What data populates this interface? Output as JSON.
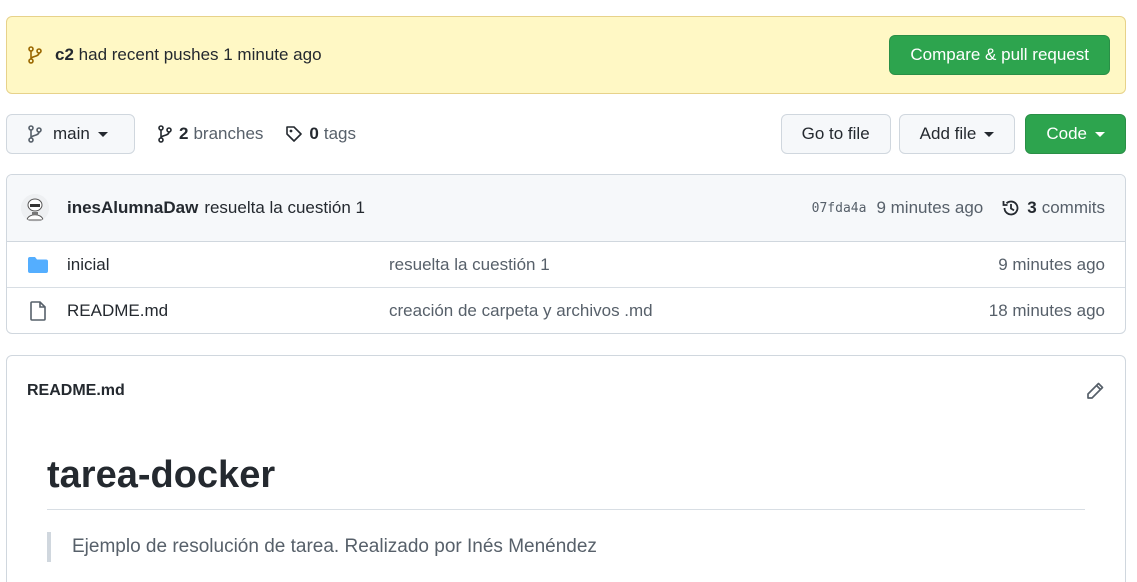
{
  "banner": {
    "branch": "c2",
    "message": "had recent pushes 1 minute ago",
    "button": "Compare & pull request"
  },
  "toolbar": {
    "branch": "main",
    "branches_count": "2",
    "branches_label": "branches",
    "tags_count": "0",
    "tags_label": "tags",
    "go_to_file": "Go to file",
    "add_file": "Add file",
    "code": "Code"
  },
  "commit": {
    "author": "inesAlumnaDaw",
    "message": "resuelta la cuestión 1",
    "sha": "07fda4a",
    "time": "9 minutes ago",
    "count": "3",
    "count_label": "commits"
  },
  "files": [
    {
      "name": "inicial",
      "icon": "folder-icon",
      "message": "resuelta la cuestión 1",
      "time": "9 minutes ago"
    },
    {
      "name": "README.md",
      "icon": "file-icon",
      "message": "creación de carpeta y archivos .md",
      "time": "18 minutes ago"
    }
  ],
  "readme": {
    "filename": "README.md",
    "heading": "tarea-docker",
    "quote": "Ejemplo de resolución de tarea. Realizado por Inés Menéndez"
  },
  "colors": {
    "green": "#2da44e",
    "banner_bg": "#fff8c5",
    "folder": "#54aeff"
  }
}
